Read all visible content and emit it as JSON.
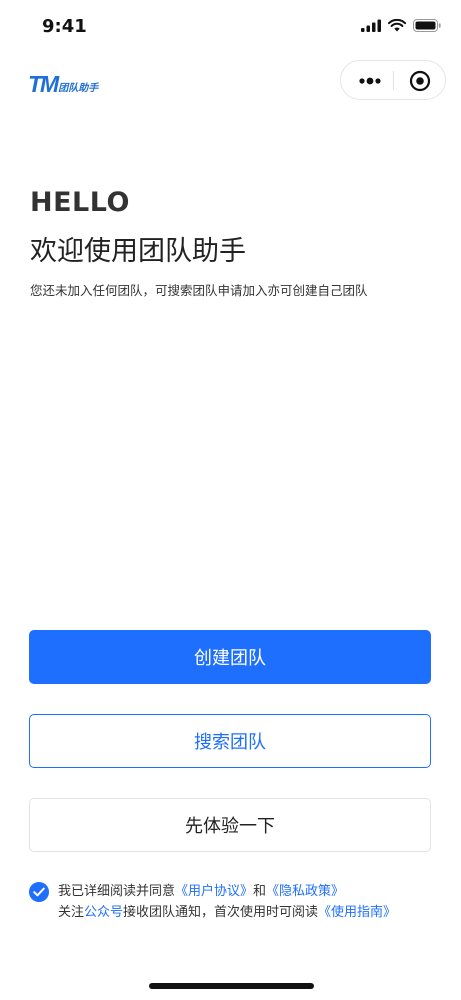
{
  "status_bar": {
    "time": "9:41"
  },
  "logo": {
    "mark": "TM",
    "text": "团队助手"
  },
  "capsule": {
    "menu_icon": "more-dots-icon",
    "close_icon": "target-circle-icon"
  },
  "hero": {
    "greeting": "HELLO",
    "title": "欢迎使用团队助手",
    "subtitle": "您还未加入任何团队，可搜索团队申请加入亦可创建自己团队"
  },
  "actions": {
    "create_label": "创建团队",
    "search_label": "搜索团队",
    "try_label": "先体验一下"
  },
  "agreement": {
    "checked": true,
    "prefix": "我已详细阅读并同意",
    "user_agreement": "《用户协议》",
    "and": "和",
    "privacy_policy": "《隐私政策》",
    "follow_prefix": "关注",
    "official_account": "公众号",
    "follow_suffix": "接收团队通知，首次使用时可阅读",
    "guide": "《使用指南》"
  },
  "colors": {
    "accent": "#1f6ffe",
    "logo": "#1f6fd6"
  }
}
